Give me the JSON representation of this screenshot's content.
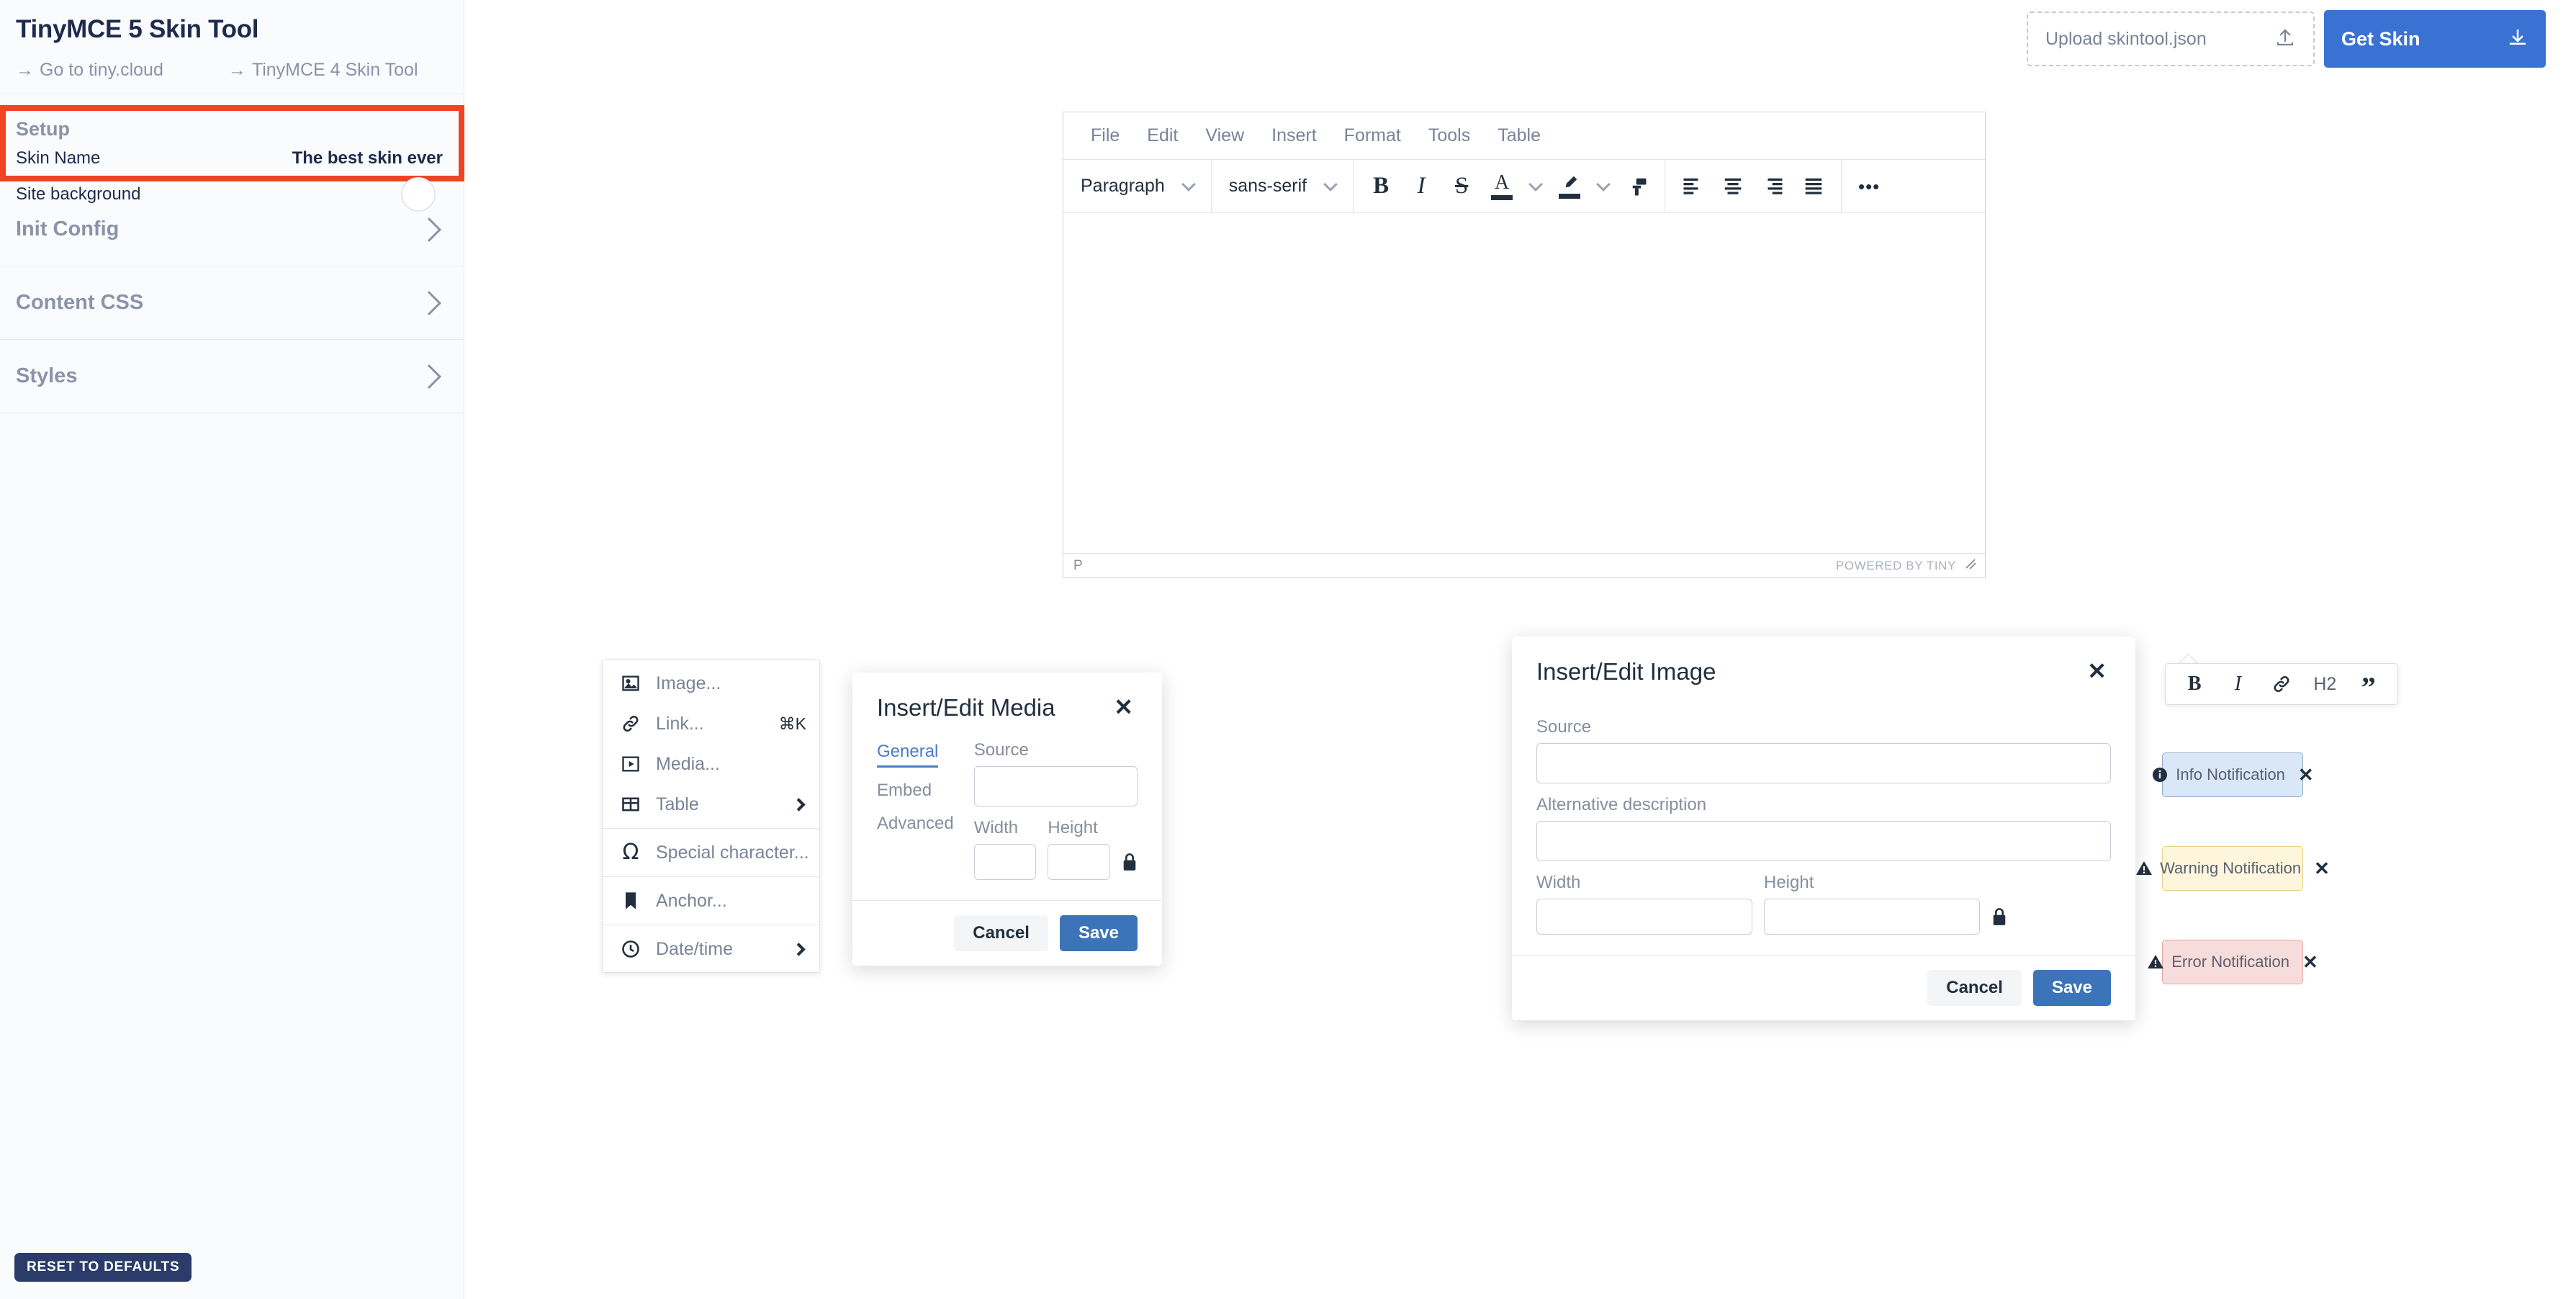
{
  "app": {
    "title": "TinyMCE 5 Skin Tool",
    "links": [
      {
        "arrow": "→",
        "label": "Go to tiny.cloud"
      },
      {
        "arrow": "→",
        "label": "TinyMCE 4 Skin Tool"
      }
    ],
    "reset_label": "RESET TO DEFAULTS"
  },
  "actions": {
    "upload_label": "Upload skintool.json",
    "upload_icon": "upload-icon",
    "get_skin_label": "Get Skin",
    "get_skin_icon": "download-icon"
  },
  "sidebar": {
    "setup": {
      "title": "Setup",
      "rows": [
        {
          "label": "Skin Name",
          "value": "The best skin ever"
        },
        {
          "label": "Site background",
          "value": ""
        }
      ],
      "toggle_name": "site-background-toggle",
      "highlight_color": "#ef4323"
    },
    "sections": [
      {
        "label": "Init Config",
        "chevron": "chevron-right-icon"
      },
      {
        "label": "Content CSS",
        "chevron": "chevron-right-icon"
      },
      {
        "label": "Styles",
        "chevron": "chevron-right-icon"
      }
    ]
  },
  "editor": {
    "menubar": [
      "File",
      "Edit",
      "View",
      "Insert",
      "Format",
      "Tools",
      "Table"
    ],
    "toolbar": {
      "block_format": "Paragraph",
      "font_family": "sans-serif",
      "buttons": [
        {
          "name": "bold-icon",
          "glyph": "B"
        },
        {
          "name": "italic-icon",
          "glyph": "I"
        },
        {
          "name": "strikethrough-icon",
          "glyph": "S"
        },
        {
          "name": "text-color-icon",
          "glyph": "A"
        },
        {
          "name": "text-color-chevron-icon",
          "glyph": "⌄"
        },
        {
          "name": "highlight-color-icon",
          "glyph": "✎"
        },
        {
          "name": "highlight-color-chevron-icon",
          "glyph": "⌄"
        },
        {
          "name": "format-painter-icon",
          "glyph": "⎙"
        },
        {
          "name": "align-left-icon",
          "glyph": ""
        },
        {
          "name": "align-center-icon",
          "glyph": ""
        },
        {
          "name": "align-right-icon",
          "glyph": ""
        },
        {
          "name": "align-justify-icon",
          "glyph": ""
        },
        {
          "name": "more-icon",
          "glyph": "•••"
        }
      ]
    },
    "statusbar": {
      "path": "P",
      "branding": "POWERED BY TINY",
      "resize_icon": "resize-handle-icon"
    }
  },
  "context_menu": {
    "items": [
      {
        "icon": "image-icon",
        "label": "Image...",
        "shortcut": "",
        "submenu": false
      },
      {
        "icon": "link-icon",
        "label": "Link...",
        "shortcut": "⌘K",
        "submenu": false
      },
      {
        "icon": "media-icon",
        "label": "Media...",
        "shortcut": "",
        "submenu": false
      },
      {
        "icon": "table-icon",
        "label": "Table",
        "shortcut": "",
        "submenu": true
      },
      {
        "icon": "special-character-icon",
        "label": "Special character...",
        "shortcut": "",
        "submenu": false
      },
      {
        "icon": "anchor-icon",
        "label": "Anchor...",
        "shortcut": "",
        "submenu": false
      },
      {
        "icon": "clock-icon",
        "label": "Date/time",
        "shortcut": "",
        "submenu": true
      }
    ]
  },
  "media_dialog": {
    "title": "Insert/Edit Media",
    "close_icon": "close-icon",
    "tabs": [
      {
        "label": "General",
        "active": true
      },
      {
        "label": "Embed",
        "active": false
      },
      {
        "label": "Advanced",
        "active": false
      }
    ],
    "fields": {
      "source_label": "Source",
      "source_value": "",
      "width_label": "Width",
      "width_value": "",
      "height_label": "Height",
      "height_value": "",
      "lock_icon": "lock-icon"
    },
    "cancel_label": "Cancel",
    "save_label": "Save"
  },
  "image_dialog": {
    "title": "Insert/Edit Image",
    "close_icon": "close-icon",
    "fields": {
      "source_label": "Source",
      "source_value": "",
      "alt_label": "Alternative description",
      "alt_value": "",
      "width_label": "Width",
      "width_value": "",
      "height_label": "Height",
      "height_value": "",
      "lock_icon": "lock-icon"
    },
    "cancel_label": "Cancel",
    "save_label": "Save"
  },
  "inline_toolbar": {
    "buttons": [
      {
        "name": "bold-icon",
        "glyph": "B"
      },
      {
        "name": "italic-icon",
        "glyph": "I"
      },
      {
        "name": "link-icon",
        "glyph": "🔗"
      },
      {
        "name": "heading-2-icon",
        "glyph": "H2"
      },
      {
        "name": "blockquote-icon",
        "glyph": "”"
      }
    ]
  },
  "notifications": [
    {
      "type": "info",
      "icon": "info-icon",
      "text": "Info Notification",
      "close_icon": "close-icon",
      "bg": "#d9e7f7",
      "border": "#8fadd1"
    },
    {
      "type": "warning",
      "icon": "warning-icon",
      "text": "Warning Notification",
      "close_icon": "close-icon",
      "bg": "#fdf6dc",
      "border": "#e8d184"
    },
    {
      "type": "error",
      "icon": "error-icon",
      "text": "Error Notification",
      "close_icon": "close-icon",
      "bg": "#f7dcdc",
      "border": "#e2a7a7"
    }
  ]
}
